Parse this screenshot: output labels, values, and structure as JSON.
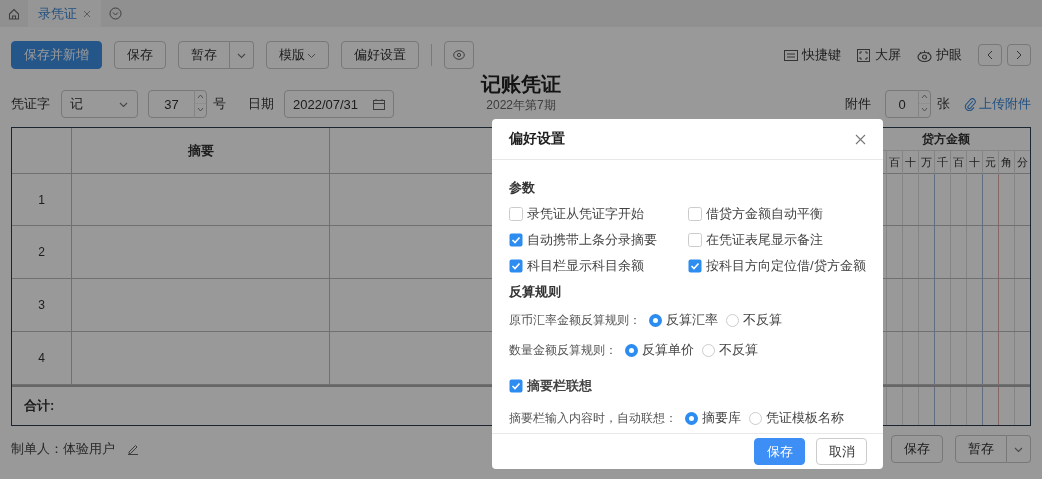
{
  "tabs": [
    {
      "label": "录凭证",
      "selected": true
    }
  ],
  "toolbar": {
    "buttons": [
      {
        "label": "保存并新增",
        "kind": "primary"
      },
      {
        "label": "保存",
        "kind": "plain"
      },
      {
        "label": "暂存",
        "kind": "split"
      },
      {
        "label": "模版",
        "kind": "dropdown"
      },
      {
        "label": "偏好设置",
        "kind": "plain"
      },
      {
        "kind": "icon"
      }
    ],
    "tools": [
      {
        "label": "快捷键",
        "kind": "keyboard"
      },
      {
        "label": "大屏",
        "kind": "fullscreen"
      },
      {
        "label": "护眼",
        "kind": "eye"
      }
    ]
  },
  "voucher": {
    "word_label": "凭证字",
    "word": "记",
    "number": "37",
    "number_suffix": "号",
    "date_label": "日期",
    "date": "2022/07/31",
    "title": "记账凭证",
    "period": "2022年第7期",
    "attachment_label": "附件",
    "attachment_count": "0",
    "attachment_unit": "张",
    "upload_link": "上传附件"
  },
  "table": {
    "summary_header": "摘要",
    "credit_header": "贷方金额",
    "digit_units": [
      "百",
      "十",
      "万",
      "千",
      "百",
      "十",
      "元",
      "角",
      "分"
    ],
    "rows": [
      "1",
      "2",
      "3",
      "4"
    ],
    "total_label": "合计:"
  },
  "footer": {
    "maker": "制单人：体验用户",
    "buttons": [
      {
        "label": "保存",
        "kind": "plain"
      },
      {
        "label": "暂存",
        "kind": "split"
      }
    ]
  },
  "dialog": {
    "title": "偏好设置",
    "blocks": [
      {
        "kind": "heading",
        "text": "参数"
      },
      {
        "kind": "checkgrid",
        "items": [
          {
            "label": "录凭证从凭证字开始",
            "checked": false
          },
          {
            "label": "借贷方金额自动平衡",
            "checked": false
          },
          {
            "label": "自动携带上条分录摘要",
            "checked": true
          },
          {
            "label": "在凭证表尾显示备注",
            "checked": false
          },
          {
            "label": "科目栏显示科目余额",
            "checked": true
          },
          {
            "label": "按科目方向定位借/贷方金额",
            "checked": true
          }
        ]
      },
      {
        "kind": "heading",
        "text": "反算规则"
      },
      {
        "kind": "radio",
        "label": "原币汇率金额反算规则：",
        "options": [
          {
            "label": "反算汇率",
            "selected": true
          },
          {
            "label": "不反算",
            "selected": false
          }
        ]
      },
      {
        "kind": "radio",
        "label": "数量金额反算规则：",
        "options": [
          {
            "label": "反算单价",
            "selected": true
          },
          {
            "label": "不反算",
            "selected": false
          }
        ]
      },
      {
        "kind": "checkbox",
        "label": "摘要栏联想",
        "checked": true
      },
      {
        "kind": "radio",
        "label": "摘要栏输入内容时，自动联想：",
        "options": [
          {
            "label": "摘要库",
            "selected": true
          },
          {
            "label": "凭证模板名称",
            "selected": false
          }
        ]
      }
    ],
    "buttons": [
      {
        "label": "保存",
        "kind": "primary"
      },
      {
        "label": "取消",
        "kind": "plain"
      }
    ]
  }
}
